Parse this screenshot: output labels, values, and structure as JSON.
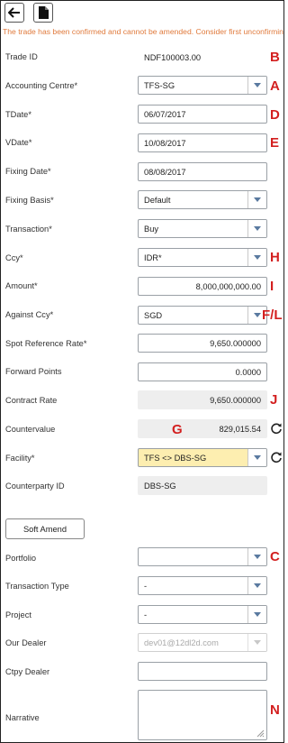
{
  "toolbar": {
    "back_icon": "arrow-left-icon",
    "doc_icon": "document-icon"
  },
  "warning": "The trade has been confirmed and cannot be amended. Consider first unconfirming the trade.",
  "fields": {
    "trade_id": {
      "label": "Trade ID",
      "value": "NDF100003.00"
    },
    "accounting_centre": {
      "label": "Accounting Centre*",
      "value": "TFS-SG"
    },
    "tdate": {
      "label": "TDate*",
      "value": "06/07/2017"
    },
    "vdate": {
      "label": "VDate*",
      "value": "10/08/2017"
    },
    "fixing_date": {
      "label": "Fixing Date*",
      "value": "08/08/2017"
    },
    "fixing_basis": {
      "label": "Fixing Basis*",
      "value": "Default"
    },
    "transaction": {
      "label": "Transaction*",
      "value": "Buy"
    },
    "ccy": {
      "label": "Ccy*",
      "value": "IDR*"
    },
    "amount": {
      "label": "Amount*",
      "value": "8,000,000,000.00"
    },
    "against_ccy": {
      "label": "Against Ccy*",
      "value": "SGD"
    },
    "spot_rate": {
      "label": "Spot Reference Rate*",
      "value": "9,650.000000"
    },
    "forward_points": {
      "label": "Forward Points",
      "value": "0.0000"
    },
    "contract_rate": {
      "label": "Contract Rate",
      "value": "9,650.000000"
    },
    "countervalue": {
      "label": "Countervalue",
      "value": "829,015.54"
    },
    "facility": {
      "label": "Facility*",
      "value": "TFS <> DBS-SG"
    },
    "counterparty_id": {
      "label": "Counterparty ID",
      "value": "DBS-SG"
    },
    "portfolio": {
      "label": "Portfolio",
      "value": ""
    },
    "transaction_type": {
      "label": "Transaction Type",
      "value": "-"
    },
    "project": {
      "label": "Project",
      "value": "-"
    },
    "our_dealer": {
      "label": "Our Dealer",
      "value": "dev01@12dl2d.com"
    },
    "ctpy_dealer": {
      "label": "Ctpy Dealer",
      "value": ""
    },
    "narrative": {
      "label": "Narrative",
      "value": ""
    }
  },
  "buttons": {
    "soft_amend": "Soft Amend"
  },
  "annotations": {
    "trade_id": "B",
    "accounting_centre": "A",
    "tdate": "D",
    "vdate": "E",
    "ccy": "H",
    "amount": "I",
    "against_ccy": "F/L",
    "contract_rate": "J",
    "countervalue": "G",
    "portfolio": "C",
    "narrative": "N"
  },
  "colors": {
    "warning": "#e07a3c",
    "annotation": "#d32020",
    "facility_highlight": "#fdeeb0",
    "readonly_bg": "#eeeeee"
  }
}
